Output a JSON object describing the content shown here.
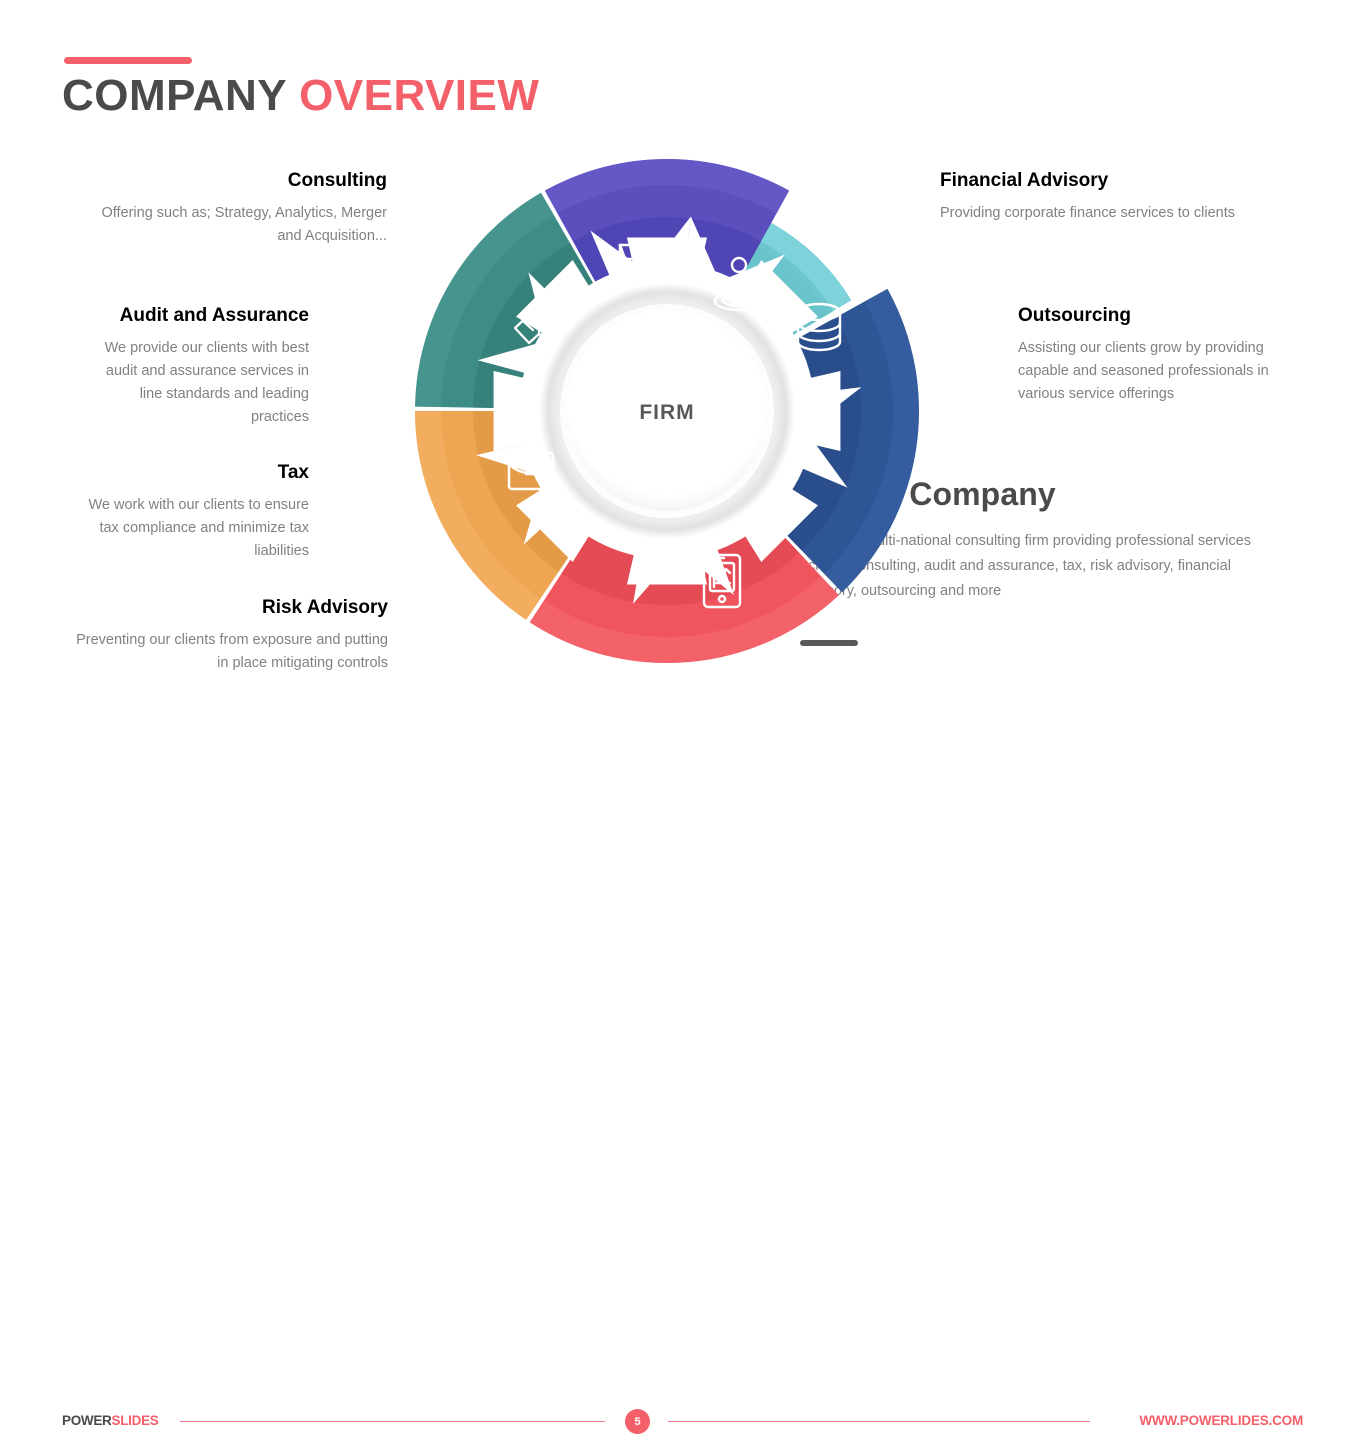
{
  "header": {
    "title_part1": "COMPANY ",
    "title_part2": "OVERVIEW",
    "accent_color": "#F4606A",
    "dark_color": "#4A4A4A"
  },
  "center": {
    "label": "FIRM"
  },
  "segments": [
    {
      "key": "consulting",
      "title": "Consulting",
      "body": "Offering such as; Strategy, Analytics, Merger and Acquisition...",
      "color": "#5B4FBE",
      "color_dark": "#4B3FAE",
      "color_light": "#6B5FCC",
      "icon": "folder-icon"
    },
    {
      "key": "financial-advisory",
      "title": "Financial Advisory",
      "body": "Providing corporate finance services to clients",
      "color": "#73CDD5",
      "color_dark": "#63BDC5",
      "color_light": "#86D8DE",
      "icon": "person-idea-icon"
    },
    {
      "key": "outsourcing",
      "title": "Outsourcing",
      "body": "Assisting our clients grow by providing capable and seasoned professionals in various service offerings",
      "color": "#2E5596",
      "color_dark": "#274A85",
      "color_light": "#3A63A6",
      "icon": "coins-stack-icon"
    },
    {
      "key": "risk-advisory",
      "title": "Risk Advisory",
      "body": "Preventing our clients from exposure and putting in place mitigating controls",
      "color": "#F0555E",
      "color_dark": "#DF4651",
      "color_light": "#F56B73",
      "icon": "tablet-chart-icon"
    },
    {
      "key": "tax",
      "title": "Tax",
      "body": "We work with our clients to ensure tax compliance and minimize tax liabilities",
      "color": "#EFA653",
      "color_dark": "#DD9441",
      "color_light": "#F5B267",
      "icon": "briefcase-icon"
    },
    {
      "key": "audit-and-assurance",
      "title": "Audit and Assurance",
      "body": "We provide our clients with best audit and assurance services in line standards and leading practices",
      "color": "#3D8D86",
      "color_dark": "#337A74",
      "color_light": "#4D9D95",
      "icon": "handshake-icon"
    }
  ],
  "profile": {
    "heading": "Profile Company",
    "body": "X.Y.Z is a multi-national consulting firm providing professional services across;  consulting, audit and assurance, tax, risk advisory, financial advisory, outsourcing and more"
  },
  "footer": {
    "brand_part1": "POWER",
    "brand_part2": "SLIDES",
    "page_number": "5",
    "website": "WWW.POWERLIDES.COM"
  }
}
